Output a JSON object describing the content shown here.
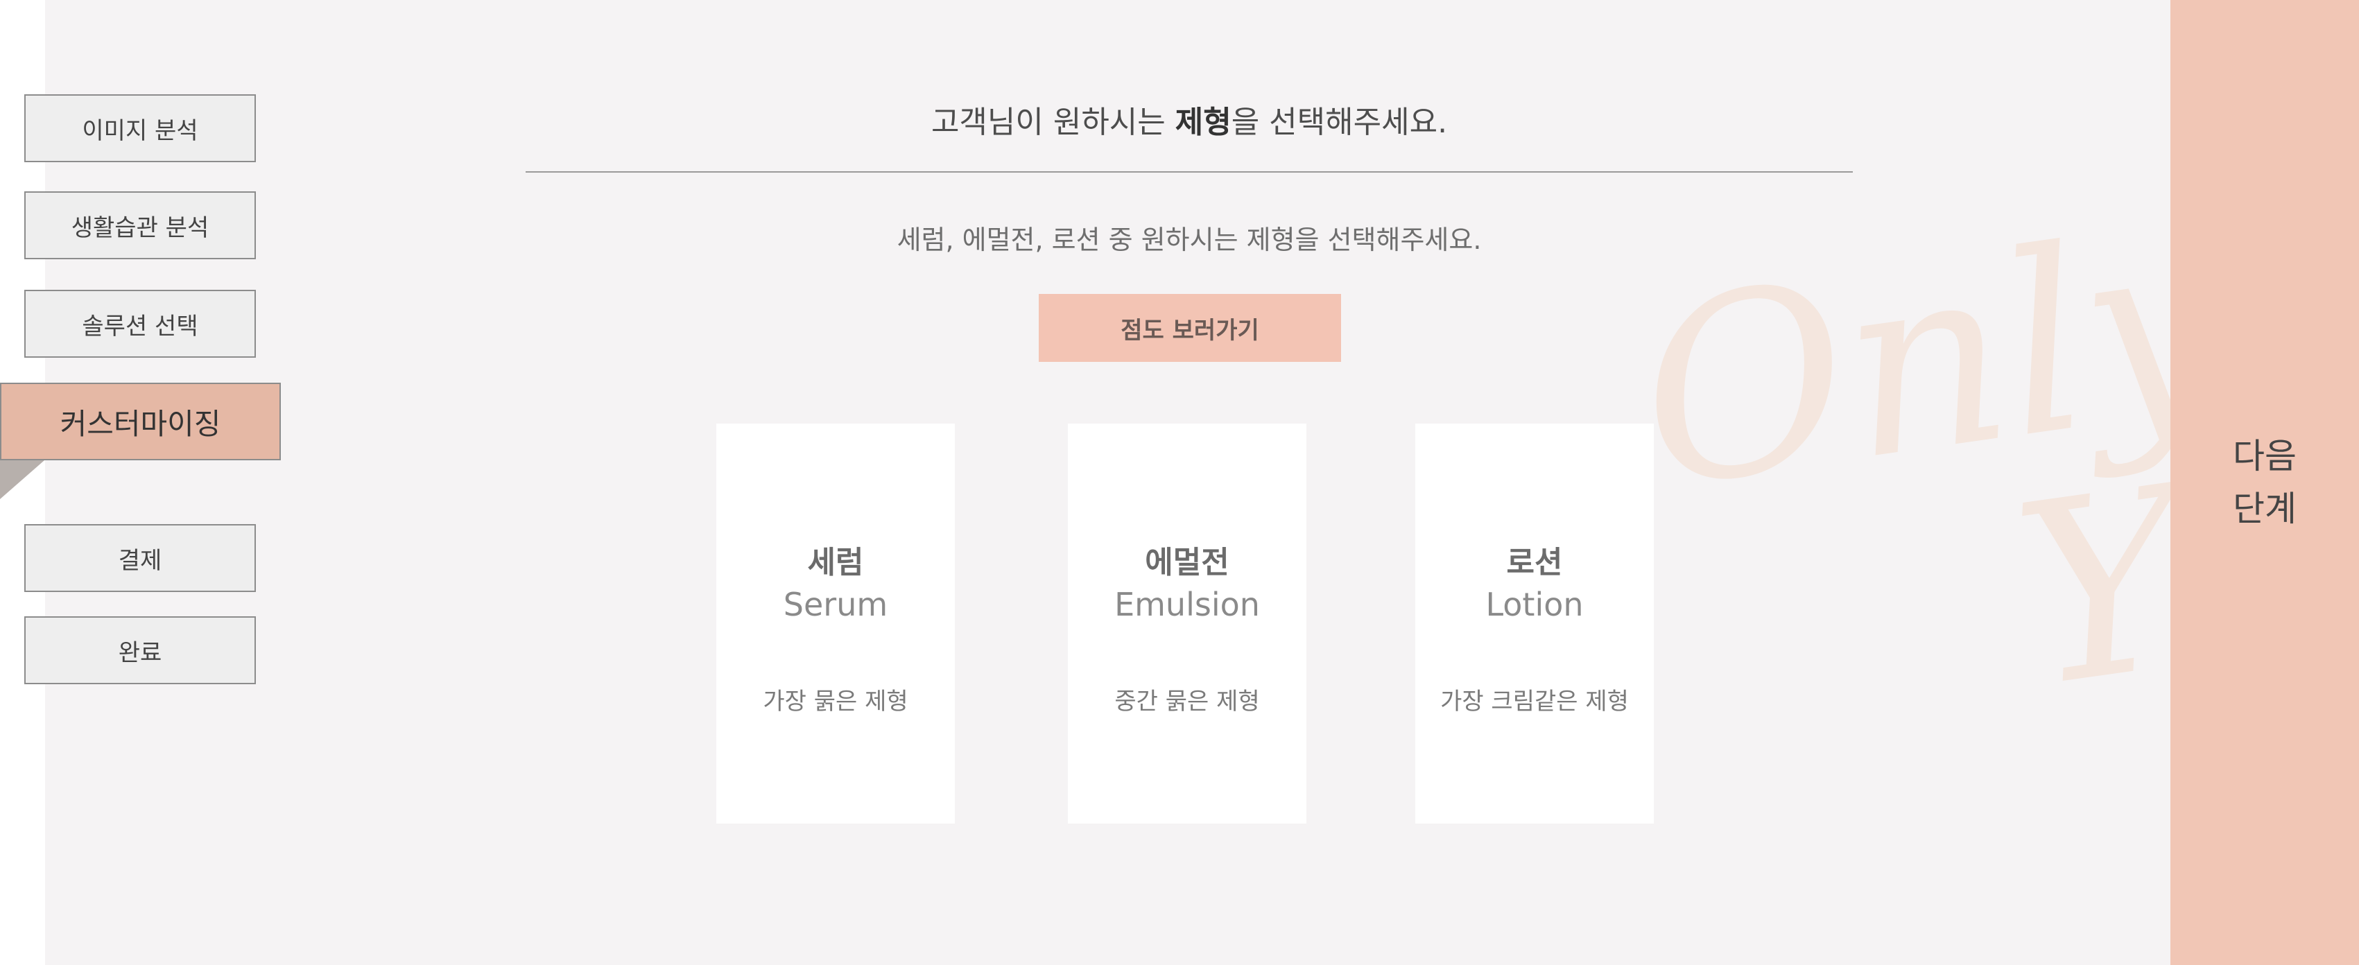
{
  "sidebar": {
    "steps": [
      {
        "label": "이미지 분석"
      },
      {
        "label": "생활습관 분석"
      },
      {
        "label": "솔루션 선택"
      },
      {
        "label": "커스터마이징"
      },
      {
        "label": "결제"
      },
      {
        "label": "완료"
      }
    ],
    "active_index": 3
  },
  "main": {
    "title_prefix": "고객님이 원하시는 ",
    "title_emphasis": "제형",
    "title_suffix": "을 선택해주세요.",
    "subtitle": "세럼, 에멀전, 로션 중 원하시는 제형을 선택해주세요.",
    "viscosity_button": "점도 보러가기",
    "cards": [
      {
        "name_ko": "세럼",
        "name_en": "Serum",
        "description": "가장 묽은 제형"
      },
      {
        "name_ko": "에멀전",
        "name_en": "Emulsion",
        "description": "중간 묽은 제형"
      },
      {
        "name_ko": "로션",
        "name_en": "Lotion",
        "description": "가장 크림같은 제형"
      }
    ]
  },
  "watermark": {
    "line1": "Only For",
    "line2": "You"
  },
  "next_panel": {
    "label_line1": "다음",
    "label_line2": "단계"
  },
  "colors": {
    "background": "#f5f3f4",
    "accent": "#f1c6b5",
    "active_step": "#e5b8a5",
    "watermark": "#f4e6de"
  }
}
